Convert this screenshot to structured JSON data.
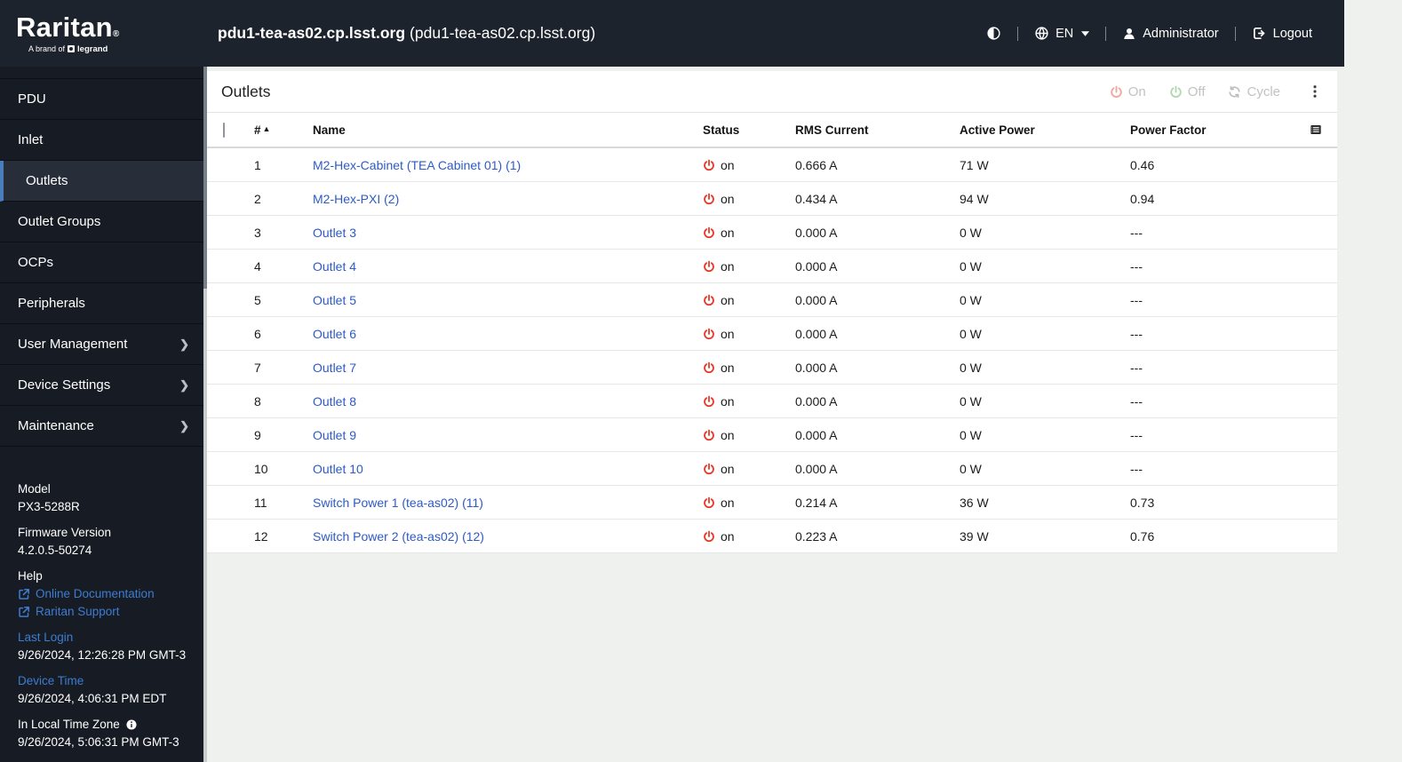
{
  "header": {
    "brand": "Raritan",
    "brand_reg": "®",
    "tagline_prefix": "A brand of",
    "tagline_brand": "legrand",
    "hostname": "pdu1-tea-as02.cp.lsst.org",
    "hostname_paren": "(pdu1-tea-as02.cp.lsst.org)",
    "language": "EN",
    "user": "Administrator",
    "logout": "Logout"
  },
  "sidebar": {
    "items": [
      {
        "label": "PDU",
        "active": false,
        "chevron": false
      },
      {
        "label": "Inlet",
        "active": false,
        "chevron": false
      },
      {
        "label": "Outlets",
        "active": true,
        "chevron": false
      },
      {
        "label": "Outlet Groups",
        "active": false,
        "chevron": false
      },
      {
        "label": "OCPs",
        "active": false,
        "chevron": false
      },
      {
        "label": "Peripherals",
        "active": false,
        "chevron": false
      },
      {
        "label": "User Management",
        "active": false,
        "chevron": true
      },
      {
        "label": "Device Settings",
        "active": false,
        "chevron": true
      },
      {
        "label": "Maintenance",
        "active": false,
        "chevron": true
      }
    ],
    "info_blocks": [
      {
        "label": "Model",
        "value": "PX3-5288R",
        "label_type": "plain"
      },
      {
        "label": "Firmware Version",
        "value": "4.2.0.5-50274",
        "label_type": "plain"
      },
      {
        "label": "Help",
        "label_type": "plain",
        "links": [
          "Online Documentation",
          "Raritan Support"
        ]
      },
      {
        "label": "Last Login",
        "value": "9/26/2024, 12:26:28 PM GMT-3",
        "label_type": "link"
      },
      {
        "label": "Device Time",
        "value": "9/26/2024, 4:06:31 PM EDT",
        "label_type": "link"
      },
      {
        "label": "In Local Time Zone",
        "value": "9/26/2024, 5:06:31 PM GMT-3",
        "label_type": "plain",
        "info_icon": true
      }
    ]
  },
  "main": {
    "title": "Outlets",
    "actions": {
      "on": "On",
      "off": "Off",
      "cycle": "Cycle"
    },
    "table": {
      "columns": {
        "num": "#",
        "name": "Name",
        "status": "Status",
        "rms": "RMS Current",
        "power": "Active Power",
        "pf": "Power Factor"
      },
      "sort_indicator": "▲",
      "rows": [
        {
          "num": "1",
          "name": "M2-Hex-Cabinet (TEA Cabinet 01) (1)",
          "status": "on",
          "rms": "0.666 A",
          "power": "71 W",
          "pf": "0.46"
        },
        {
          "num": "2",
          "name": "M2-Hex-PXI (2)",
          "status": "on",
          "rms": "0.434 A",
          "power": "94 W",
          "pf": "0.94"
        },
        {
          "num": "3",
          "name": "Outlet 3",
          "status": "on",
          "rms": "0.000 A",
          "power": "0 W",
          "pf": "---"
        },
        {
          "num": "4",
          "name": "Outlet 4",
          "status": "on",
          "rms": "0.000 A",
          "power": "0 W",
          "pf": "---"
        },
        {
          "num": "5",
          "name": "Outlet 5",
          "status": "on",
          "rms": "0.000 A",
          "power": "0 W",
          "pf": "---"
        },
        {
          "num": "6",
          "name": "Outlet 6",
          "status": "on",
          "rms": "0.000 A",
          "power": "0 W",
          "pf": "---"
        },
        {
          "num": "7",
          "name": "Outlet 7",
          "status": "on",
          "rms": "0.000 A",
          "power": "0 W",
          "pf": "---"
        },
        {
          "num": "8",
          "name": "Outlet 8",
          "status": "on",
          "rms": "0.000 A",
          "power": "0 W",
          "pf": "---"
        },
        {
          "num": "9",
          "name": "Outlet 9",
          "status": "on",
          "rms": "0.000 A",
          "power": "0 W",
          "pf": "---"
        },
        {
          "num": "10",
          "name": "Outlet 10",
          "status": "on",
          "rms": "0.000 A",
          "power": "0 W",
          "pf": "---"
        },
        {
          "num": "11",
          "name": "Switch Power 1 (tea-as02) (11)",
          "status": "on",
          "rms": "0.214 A",
          "power": "36 W",
          "pf": "0.73"
        },
        {
          "num": "12",
          "name": "Switch Power 2 (tea-as02) (12)",
          "status": "on",
          "rms": "0.223 A",
          "power": "39 W",
          "pf": "0.76"
        }
      ]
    }
  },
  "colors": {
    "header_bg": "#1d232d",
    "sidebar_bg": "#171c24",
    "active_accent_blue": "#4a7dbb",
    "link_blue": "#2d5ac7",
    "sidebar_link_blue": "#3d7cd0",
    "status_on_red": "#e83223",
    "disabled_on_red": "#f0a9a1",
    "disabled_off_green": "#b2d8af"
  }
}
